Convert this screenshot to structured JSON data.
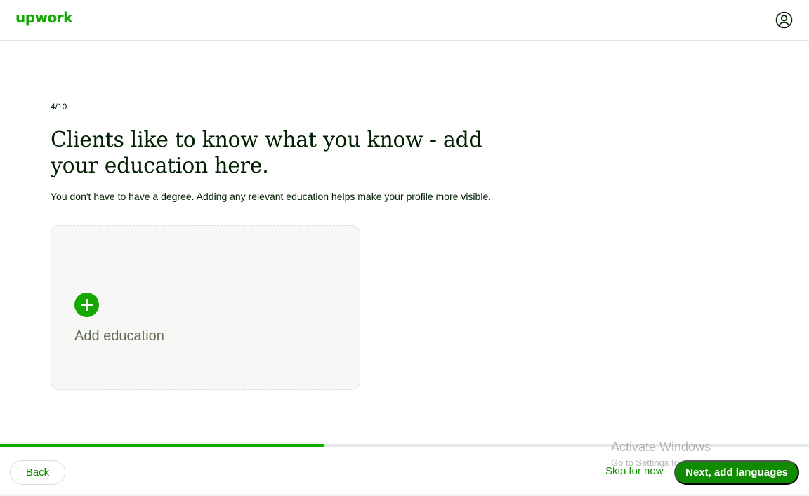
{
  "header": {
    "logo_text": "upwork",
    "account_icon": "user-circle-icon"
  },
  "main": {
    "step_indicator": "4/10",
    "headline": "Clients like to know what you know - add your education here.",
    "subtext": "You don't have to have a degree. Adding any relevant education helps make your profile more visible.",
    "add_card": {
      "icon": "plus-circle-icon",
      "label": "Add education"
    }
  },
  "progress": {
    "fraction": 0.4
  },
  "footer": {
    "back_label": "Back",
    "skip_label": "Skip for now",
    "next_label": "Next, add languages"
  },
  "os_watermark": {
    "title": "Activate Windows",
    "subtitle": "Go to Settings to activate Windows."
  },
  "colors": {
    "brand_green": "#14a800",
    "button_green": "#108a00",
    "text_dark": "#001e00"
  }
}
